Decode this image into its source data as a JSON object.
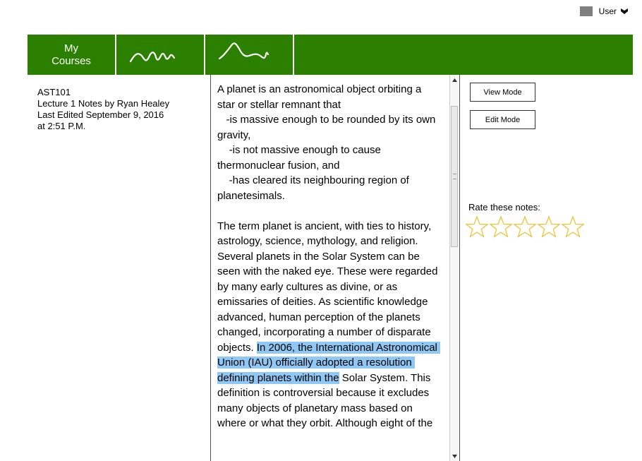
{
  "user": {
    "name": "User",
    "avatar_color": "#7f7f7f"
  },
  "nav": {
    "courses_line1": "My",
    "courses_line2": "Courses",
    "items": [
      {
        "icon": "squiggle-wave-icon"
      },
      {
        "icon": "squiggle-peak-icon"
      }
    ],
    "bg_color": "#2b8000"
  },
  "course": {
    "code": "AST101",
    "title": "Lecture 1 Notes by Ryan Healey",
    "edited": "Last Edited September 9, 2016",
    "edited_time": "at 2:51 P.M."
  },
  "notes": {
    "part1": "A planet is an astronomical object orbiting a star or stellar remnant that\n   -is massive enough to be rounded by its own gravity,\n    -is not massive enough to cause thermonuclear fusion, and\n    -has cleared its neighbouring region of planetesimals.\n\nThe term planet is ancient, with ties to history, astrology, science, mythology, and religion. Several planets in the Solar System can be seen with the naked eye. These were regarded by many early cultures as divine, or as emissaries of deities. As scientific knowledge advanced, human perception of the planets changed, incorporating a number of disparate objects. ",
    "highlight": "In 2006, the International Astronomical Union (IAU) officially adopted a resolution defining planets within the",
    "part2": " Solar System. This definition is controversial because it excludes many objects of planetary mass based on where or what they orbit. Although eight of the"
  },
  "buttons": {
    "view_mode": "View Mode",
    "edit_mode": "Edit Mode"
  },
  "rating": {
    "label": "Rate these notes:",
    "max": 5,
    "value": 0,
    "star_color": "#e8c53a"
  }
}
